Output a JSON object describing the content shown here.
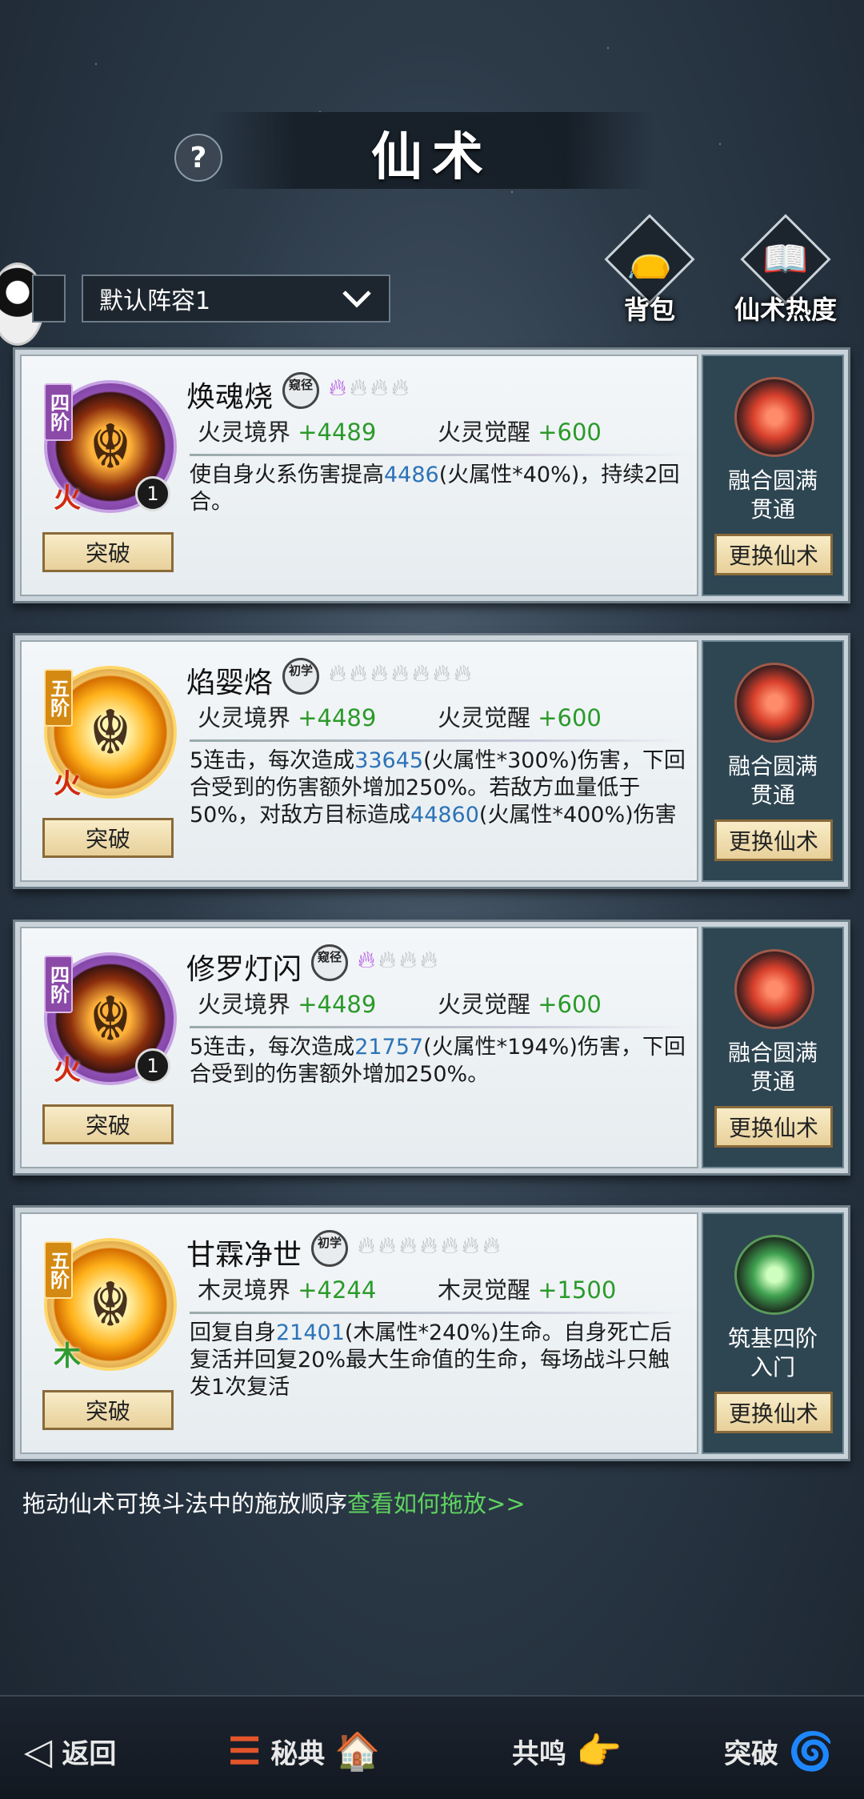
{
  "header": {
    "title": "仙术",
    "help_icon": "?"
  },
  "lineup": {
    "selected": "默认阵容1"
  },
  "top_buttons": [
    {
      "label": "背包",
      "icon": "bag-icon"
    },
    {
      "label": "仙术热度",
      "icon": "book-flame-icon"
    }
  ],
  "skills": [
    {
      "tier": "四阶",
      "tier_color": "purple",
      "element": "火",
      "count": "1",
      "name": "焕魂烧",
      "rank": "窥径",
      "flames_total": 4,
      "flames_on": 1,
      "stat1_label": "火灵境界",
      "stat1_value": "+4489",
      "stat2_label": "火灵觉醒",
      "stat2_value": "+600",
      "desc_parts": [
        "使自身火系伤害提高",
        "4486",
        "(火属性*40%)，持续2回合。"
      ],
      "emblem_label_1": "融合圆满",
      "emblem_label_2": "贯通",
      "emblem": "fire",
      "break_label": "突破",
      "change_label": "更换仙术"
    },
    {
      "tier": "五阶",
      "tier_color": "gold",
      "element": "火",
      "count": "",
      "name": "焰婴烙",
      "rank": "初学",
      "flames_total": 7,
      "flames_on": 0,
      "stat1_label": "火灵境界",
      "stat1_value": "+4489",
      "stat2_label": "火灵觉醒",
      "stat2_value": "+600",
      "desc_parts": [
        "5连击，每次造成",
        "33645",
        "(火属性*300%)伤害，下回合受到的伤害额外增加250%。若敌方血量低于50%，对敌方目标造成",
        "44860",
        "(火属性*400%)伤害"
      ],
      "emblem_label_1": "融合圆满",
      "emblem_label_2": "贯通",
      "emblem": "fire",
      "break_label": "突破",
      "change_label": "更换仙术"
    },
    {
      "tier": "四阶",
      "tier_color": "purple",
      "element": "火",
      "count": "1",
      "name": "修罗灯闪",
      "rank": "窥径",
      "flames_total": 4,
      "flames_on": 1,
      "stat1_label": "火灵境界",
      "stat1_value": "+4489",
      "stat2_label": "火灵觉醒",
      "stat2_value": "+600",
      "desc_parts": [
        "5连击，每次造成",
        "21757",
        "(火属性*194%)伤害，下回合受到的伤害额外增加250%。"
      ],
      "emblem_label_1": "融合圆满",
      "emblem_label_2": "贯通",
      "emblem": "fire",
      "break_label": "突破",
      "change_label": "更换仙术"
    },
    {
      "tier": "五阶",
      "tier_color": "gold",
      "element": "木",
      "count": "",
      "name": "甘霖净世",
      "rank": "初学",
      "flames_total": 7,
      "flames_on": 0,
      "stat1_label": "木灵境界",
      "stat1_value": "+4244",
      "stat2_label": "木灵觉醒",
      "stat2_value": "+1500",
      "desc_parts": [
        "回复自身",
        "21401",
        "(木属性*240%)生命。自身死亡后复活并回复20%最大生命值的生命，每场战斗只触发1次复活"
      ],
      "emblem_label_1": "筑基四阶",
      "emblem_label_2": "入门",
      "emblem": "wood",
      "break_label": "突破",
      "change_label": "更换仙术"
    }
  ],
  "hint": {
    "text": "拖动仙术可换斗法中的施放顺序",
    "link": "查看如何拖放>>"
  },
  "bottom_nav": [
    {
      "label": "返回",
      "icon": "back-arrow-icon"
    },
    {
      "label": "秘典",
      "icon": "list-icon"
    },
    {
      "label": "共鸣",
      "icon": "hand-icon"
    },
    {
      "label": "突破",
      "icon": "swirl-icon"
    }
  ],
  "colors": {
    "accent_green": "#5fd45f",
    "value_blue": "#2c73b8"
  }
}
